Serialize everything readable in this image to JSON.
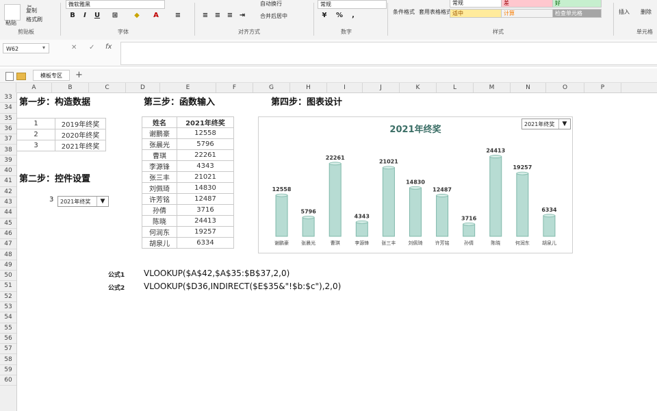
{
  "ribbon": {
    "paste_label": "粘贴",
    "cut_label": "剪切",
    "copy_label": "复制",
    "format_painter_label": "格式刷",
    "clipboard_group": "剪贴板",
    "font_name": "微软雅黑",
    "font_group": "字体",
    "wrap_text_label": "自动换行",
    "merge_center_label": "合并后居中",
    "align_group": "对齐方式",
    "number_format": "常规",
    "number_group": "数字",
    "cond_format_label": "条件格式",
    "table_format_label": "套用表格格式",
    "styles_group": "样式",
    "style_normal": "常规",
    "style_bad": "差",
    "style_good": "好",
    "style_neutral": "适中",
    "style_calc": "计算",
    "style_check": "检查单元格",
    "insert_label": "插入",
    "delete_label": "删除",
    "cells_group": "单元格"
  },
  "formula_bar": {
    "name_box": "W62",
    "fx": "fx"
  },
  "sheet_tabs": {
    "tab1": "模板专区"
  },
  "columns": [
    "A",
    "B",
    "C",
    "D",
    "E",
    "F",
    "G",
    "H",
    "I",
    "J",
    "K",
    "L",
    "M",
    "N",
    "O",
    "P"
  ],
  "rows": [
    "33",
    "34",
    "35",
    "36",
    "37",
    "38",
    "39",
    "40",
    "41",
    "42",
    "43",
    "44",
    "45",
    "46",
    "47",
    "48",
    "49",
    "50",
    "51",
    "52",
    "53",
    "54",
    "55",
    "56",
    "57",
    "58",
    "59",
    "60"
  ],
  "step1": {
    "heading": "第一步：构造数据",
    "rows": [
      {
        "id": "1",
        "label": "2019年终奖"
      },
      {
        "id": "2",
        "label": "2020年终奖"
      },
      {
        "id": "3",
        "label": "2021年终奖"
      }
    ]
  },
  "step2": {
    "heading": "第二步：控件设置",
    "cell_value": "3",
    "dropdown_value": "2021年终奖"
  },
  "step3": {
    "heading": "第三步：函数输入",
    "col_name": "姓名",
    "col_bonus": "2021年终奖",
    "rows": [
      {
        "name": "谢鹏豪",
        "value": "12558"
      },
      {
        "name": "张晨光",
        "value": "5796"
      },
      {
        "name": "曹琪",
        "value": "22261"
      },
      {
        "name": "李源锋",
        "value": "4343"
      },
      {
        "name": "张三丰",
        "value": "21021"
      },
      {
        "name": "刘佩琦",
        "value": "14830"
      },
      {
        "name": "许芳铭",
        "value": "12487"
      },
      {
        "name": "孙倩",
        "value": "3716"
      },
      {
        "name": "陈晓",
        "value": "24413"
      },
      {
        "name": "何润东",
        "value": "19257"
      },
      {
        "name": "胡泉儿",
        "value": "6334"
      }
    ]
  },
  "step4": {
    "heading": "第四步：图表设计",
    "dropdown_value": "2021年终奖"
  },
  "chart_data": {
    "type": "bar",
    "title": "2021年终奖",
    "categories": [
      "谢鹏豪",
      "张晨光",
      "曹琪",
      "李源锋",
      "张三丰",
      "刘佩琦",
      "许芳铭",
      "孙倩",
      "陈晓",
      "何润东",
      "胡泉儿"
    ],
    "values": [
      12558,
      5796,
      22261,
      4343,
      21021,
      14830,
      12487,
      3716,
      24413,
      19257,
      6334
    ],
    "ylim": [
      0,
      26000
    ],
    "grid": false,
    "legend": "none",
    "bar_color": "#b7dcd3",
    "bar_edge": "#7fb8aa",
    "title_color": "#3b6e66"
  },
  "formulas": {
    "label1": "公式1",
    "formula1": "VLOOKUP($A$42,$A$35:$B$37,2,0)",
    "label2": "公式2",
    "formula2": "VLOOKUP($D36,INDIRECT($E$35&\"!$b:$c\"),2,0)"
  }
}
